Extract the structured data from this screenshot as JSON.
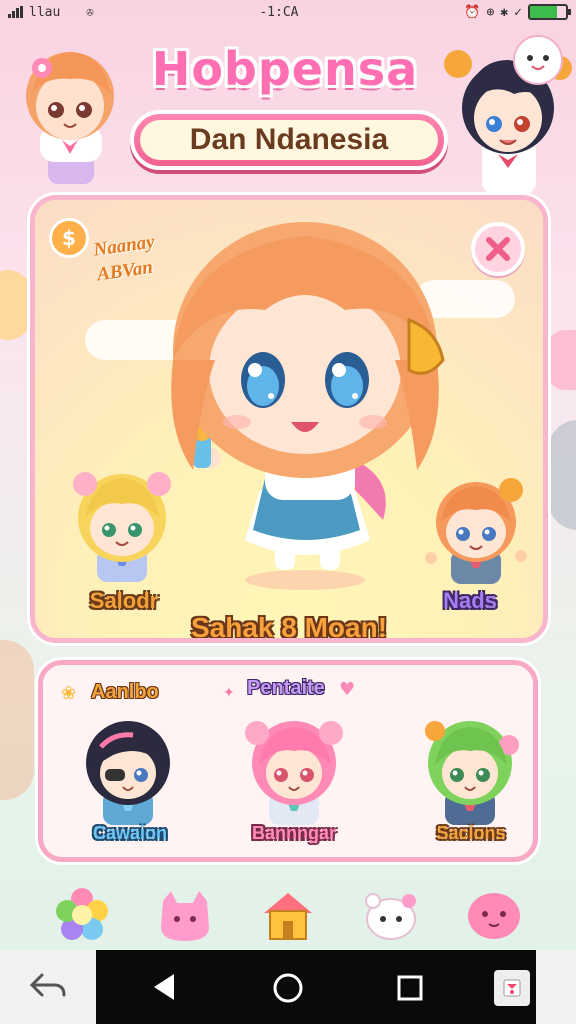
{
  "status_bar": {
    "carrier": "llau",
    "time": "-1:CA",
    "battery_level": 0.75,
    "icons": [
      "signal-icon",
      "camera-icon",
      "alarm-icon",
      "location-icon",
      "bluetooth-icon",
      "nfc-icon",
      "battery-icon"
    ]
  },
  "header": {
    "app_title": "Hobpensa",
    "subtitle_button": "Dan Ndanesia"
  },
  "main_card": {
    "reward_label_line1": "Naanay",
    "reward_label_line2": "ABVan",
    "left_character_name": "Salodr",
    "right_character_name": "Nads",
    "banner_text": "Sahak 8 Moan!"
  },
  "lower_card": {
    "section_left_label": "Aanlbo",
    "section_center_label": "Pentaite",
    "friends": [
      {
        "name": "Cawaion"
      },
      {
        "name": "Bannngar"
      },
      {
        "name": "Sacions"
      }
    ]
  },
  "bottom_tabs": [
    {
      "icon": "flower-icon"
    },
    {
      "icon": "pet-icon"
    },
    {
      "icon": "home-icon"
    },
    {
      "icon": "ghost-icon"
    },
    {
      "icon": "blob-icon"
    }
  ],
  "colors": {
    "accent_pink": "#f2628f",
    "card_yellow": "#fde6b2",
    "nav_bar": "#0a0a0a"
  }
}
